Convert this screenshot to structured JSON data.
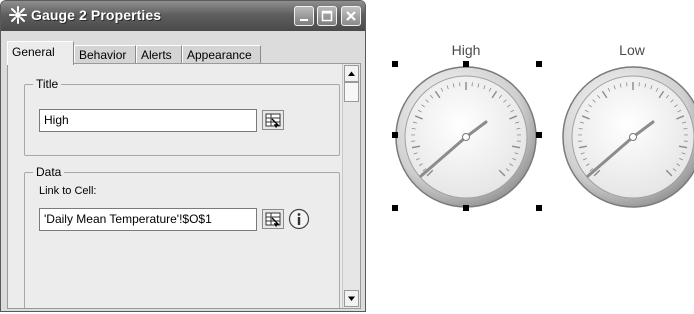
{
  "window": {
    "title": "Gauge 2 Properties",
    "controls": [
      "minimize",
      "maximize",
      "close"
    ]
  },
  "tabs": [
    {
      "label": "General",
      "active": true
    },
    {
      "label": "Behavior",
      "active": false
    },
    {
      "label": "Alerts",
      "active": false
    },
    {
      "label": "Appearance",
      "active": false
    }
  ],
  "title_group": {
    "label": "Title",
    "value": "High"
  },
  "data_group": {
    "label": "Data",
    "link_label": "Link to Cell:",
    "link_value": "'Daily Mean Temperature'!$O$1"
  },
  "gauges": [
    {
      "name": "High",
      "selected": true
    },
    {
      "name": "Low",
      "selected": false
    }
  ],
  "icons": {
    "title_icon": "gauge-app-icon",
    "pick_button": "cell-picker-icon",
    "info_button": "info-icon"
  },
  "colors": {
    "titlebar": "#5f5f5f",
    "panel": "#ececec",
    "gauge_needle": "#8c8c8c"
  }
}
